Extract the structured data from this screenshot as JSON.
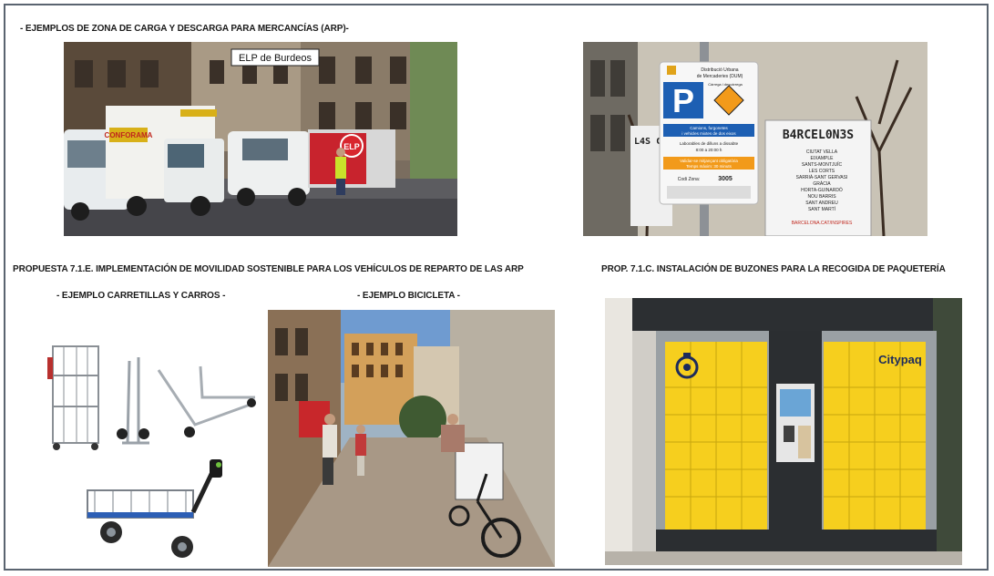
{
  "headings": {
    "arp_examples": "- EJEMPLOS DE ZONA DE CARGA Y DESCARGA PARA MERCANCÍAS (ARP)-",
    "proposal_e": "PROPUESTA 7.1.E. IMPLEMENTACIÓN DE MOVILIDAD SOSTENIBLE PARA LOS VEHÍCULOS DE REPARTO DE LAS ARP",
    "proposal_c": "PROP. 7.1.C. INSTALACIÓN DE BUZONES PARA LA RECOGIDA DE PAQUETERÍA",
    "carts_example": "- EJEMPLO CARRETILLAS Y CARROS -",
    "bike_example": "- EJEMPLO BICICLETA -"
  },
  "photos": {
    "bordeaux": {
      "caption": "ELP de Burdeos",
      "truck_brand": "CONFORAMA",
      "kiosk_brand": "ELP"
    },
    "barcelona_sign": {
      "title_line1": "Distribució Urbana",
      "title_line2": "de Mercaderies (DUM)",
      "parking_letter": "P",
      "hours_note": "Càrrega i descàrrega",
      "vehicles_line1": "Camions, furgonetes",
      "vehicles_line2": "i vehicles mixtes de dos eixos",
      "schedule_line1": "Laborables de dilluns a dissabte",
      "schedule_line2": "8:00 a 20:00 h",
      "ticket_line1": "Validar-se mitjançant obligatòria",
      "ticket_line2": "Temps màxim: 30 minuts",
      "zone_label": "Codi Zona:",
      "zone_code": "3005",
      "side_sign_title": "B4RCEL0N3S",
      "side_sign_list": [
        "CIUTAT VELLA",
        "EIXAMPLE",
        "SANTS-MONTJUÏC",
        "LES CORTS",
        "SARRIÀ-SANT GERVASI",
        "GRÀCIA",
        "HORTA-GUINARDÓ",
        "NOU BARRIS",
        "SANT ANDREU",
        "SANT MARTÍ"
      ],
      "side_sign_url": "BARCELONA.CAT/INSPIRES",
      "left_sign_text": "L4S C"
    },
    "lockers": {
      "brand": "Citypaq"
    }
  },
  "colors": {
    "locker_yellow": "#f6cf1e",
    "sign_blue": "#1d5fb3",
    "frame_border": "#5a6470"
  }
}
